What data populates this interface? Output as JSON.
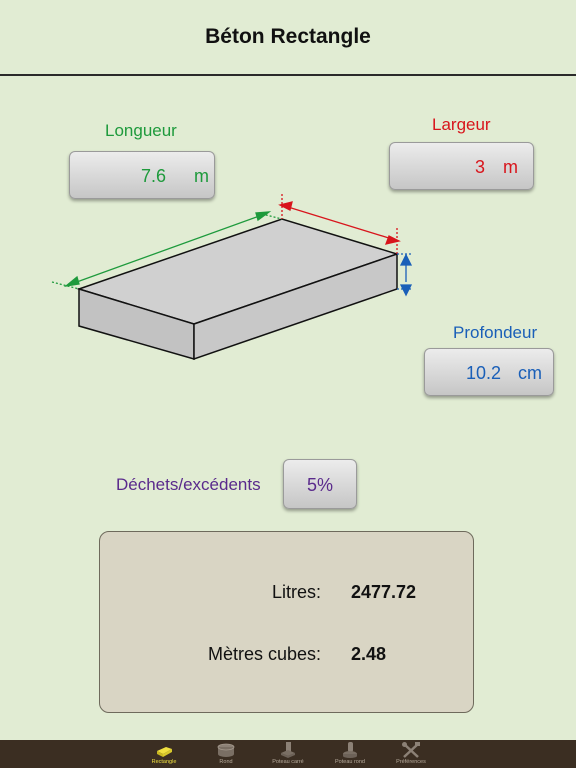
{
  "header": {
    "title": "Béton Rectangle"
  },
  "inputs": {
    "length": {
      "label": "Longueur",
      "value": "7.6",
      "unit": "m"
    },
    "width": {
      "label": "Largeur",
      "value": "3",
      "unit": "m"
    },
    "depth": {
      "label": "Profondeur",
      "value": "10.2",
      "unit": "cm"
    },
    "waste": {
      "label": "Déchets/excédents",
      "value": "5%"
    }
  },
  "results": {
    "liters_label": "Litres:",
    "liters_value": "2477.72",
    "cubic_label": "Mètres cubes:",
    "cubic_value": "2.48"
  },
  "tabs": [
    {
      "label": "Rectangle",
      "icon": "rectangle-slab-icon",
      "active": true
    },
    {
      "label": "Rond",
      "icon": "cylinder-icon",
      "active": false
    },
    {
      "label": "Poteau carré",
      "icon": "square-post-icon",
      "active": false
    },
    {
      "label": "Poteau rond",
      "icon": "round-post-icon",
      "active": false
    },
    {
      "label": "Préférences",
      "icon": "tools-icon",
      "active": false
    }
  ],
  "colors": {
    "background": "#e1ecd3",
    "length": "#1e9a3c",
    "width": "#d8151c",
    "depth": "#1a5fb8",
    "waste": "#5a2a8c",
    "tab_active": "#f0e040"
  }
}
